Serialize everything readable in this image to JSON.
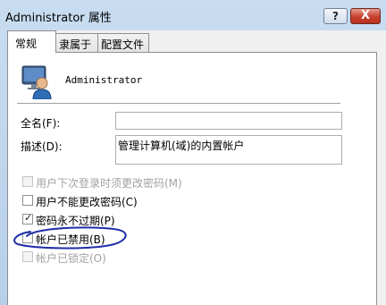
{
  "window": {
    "title": "Administrator 属性",
    "help_label": "?",
    "close_label": "X"
  },
  "tabs": [
    {
      "label": "常规",
      "active": true
    },
    {
      "label": "隶属于",
      "active": false
    },
    {
      "label": "配置文件",
      "active": false
    }
  ],
  "user": {
    "name": "Administrator",
    "icon": "user-monitor-icon"
  },
  "fields": {
    "fullname_label": "全名(F):",
    "fullname_value": "",
    "description_label": "描述(D):",
    "description_value": "管理计算机(域)的内置帐户"
  },
  "checkboxes": [
    {
      "label": "用户下次登录时须更改密码(M)",
      "checked": false,
      "enabled": false
    },
    {
      "label": "用户不能更改密码(C)",
      "checked": false,
      "enabled": true
    },
    {
      "label": "密码永不过期(P)",
      "checked": true,
      "enabled": true
    },
    {
      "label": "帐户已禁用(B)",
      "checked": false,
      "enabled": true
    },
    {
      "label": "帐户已锁定(O)",
      "checked": false,
      "enabled": false
    }
  ],
  "colors": {
    "annotation": "#1f2ea8",
    "close_button": "#c7412f"
  }
}
